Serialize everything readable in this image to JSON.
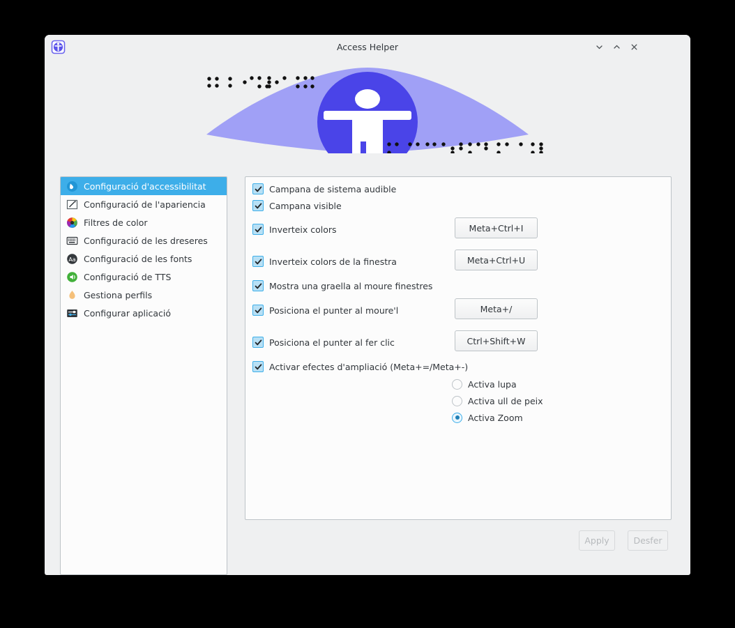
{
  "window": {
    "title": "Access Helper",
    "app_icon": "accessibility-icon",
    "controls": [
      {
        "name": "minimize-button",
        "icon": "chevron-down-icon"
      },
      {
        "name": "maximize-button",
        "icon": "chevron-up-icon"
      },
      {
        "name": "close-button",
        "icon": "close-icon"
      }
    ]
  },
  "banner": {
    "icon": "accessibility-person-icon",
    "decoration": "braille-dots",
    "colors": {
      "lens": "#9b9bf5",
      "circle": "#4a44e8",
      "figure": "#ffffff"
    }
  },
  "sidebar": {
    "items": [
      {
        "label": "Configuració d'accessibilitat",
        "icon": "accessibility-icon",
        "selected": true
      },
      {
        "label": "Configuració de l'apariencia",
        "icon": "appearance-pencil-icon",
        "selected": false
      },
      {
        "label": "Filtres de color",
        "icon": "color-wheel-icon",
        "selected": false
      },
      {
        "label": "Configuració de les dreseres",
        "icon": "keyboard-icon",
        "selected": false
      },
      {
        "label": "Configuració de les fonts",
        "icon": "font-aa-icon",
        "selected": false
      },
      {
        "label": "Configuració de TTS",
        "icon": "tts-speaker-icon",
        "selected": false
      },
      {
        "label": "Gestiona perfils",
        "icon": "profile-flame-icon",
        "selected": false
      },
      {
        "label": "Configurar aplicació",
        "icon": "sliders-icon",
        "selected": false
      }
    ]
  },
  "main": {
    "options": [
      {
        "label": "Campana de sistema audible",
        "checked": true,
        "shortcut": null
      },
      {
        "label": "Campana visible",
        "checked": true,
        "shortcut": null
      },
      {
        "label": "Inverteix colors",
        "checked": true,
        "shortcut": "Meta+Ctrl+I"
      },
      {
        "label": "Inverteix colors de la finestra",
        "checked": true,
        "shortcut": "Meta+Ctrl+U"
      },
      {
        "label": "Mostra una graella al moure finestres",
        "checked": true,
        "shortcut": null
      },
      {
        "label": "Posiciona el punter al moure'l",
        "checked": true,
        "shortcut": "Meta+/"
      },
      {
        "label": "Posiciona el punter al fer clic",
        "checked": true,
        "shortcut": "Ctrl+Shift+W"
      },
      {
        "label": "Activar efectes d'ampliació (Meta+=/Meta+-)",
        "checked": true,
        "shortcut": null
      }
    ],
    "magnifier_modes": [
      {
        "label": "Activa lupa",
        "selected": false
      },
      {
        "label": "Activa ull de peix",
        "selected": false
      },
      {
        "label": "Activa Zoom",
        "selected": true
      }
    ]
  },
  "footer": {
    "apply_label": "Apply",
    "undo_label": "Desfer"
  },
  "theme": {
    "accent": "#3daee9",
    "window_bg": "#eff0f1",
    "panel_bg": "#fcfcfc",
    "border": "#bdc3c7",
    "text": "#31363b",
    "disabled_text": "#b7babd"
  }
}
